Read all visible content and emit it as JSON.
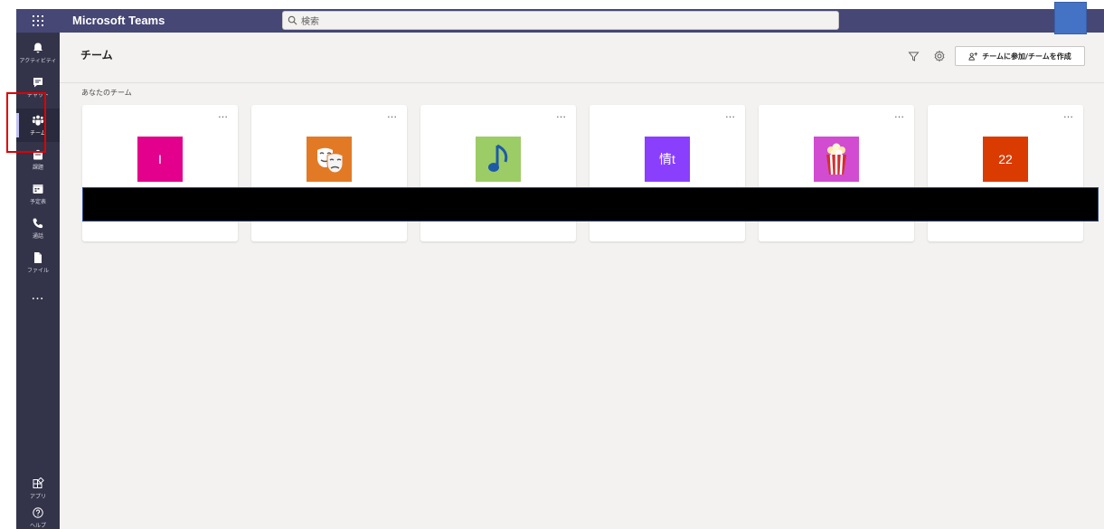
{
  "app": {
    "title": "Microsoft Teams"
  },
  "search": {
    "placeholder": "検索"
  },
  "rail": {
    "items": [
      {
        "label": "アクティビティ",
        "icon": "bell-icon"
      },
      {
        "label": "チャット",
        "icon": "chat-icon"
      },
      {
        "label": "チーム",
        "icon": "teams-icon",
        "active": true
      },
      {
        "label": "課題",
        "icon": "assignments-icon"
      },
      {
        "label": "予定表",
        "icon": "calendar-icon"
      },
      {
        "label": "通話",
        "icon": "phone-icon"
      },
      {
        "label": "ファイル",
        "icon": "file-icon"
      }
    ],
    "more": "…",
    "bottom": [
      {
        "label": "アプリ",
        "icon": "apps-icon"
      },
      {
        "label": "ヘルプ",
        "icon": "help-icon"
      }
    ]
  },
  "header": {
    "title": "チーム",
    "join_button": "チームに参加/チームを作成",
    "filter_icon": "filter-icon",
    "settings_icon": "gear-icon"
  },
  "section": {
    "label": "あなたのチーム"
  },
  "cards": [
    {
      "tile_text": "I",
      "tile_color": "#e3008c",
      "more": "…"
    },
    {
      "tile_text": "",
      "tile_color": "#e27a25",
      "icon": "theater-masks-icon",
      "more": "…"
    },
    {
      "tile_text": "",
      "tile_color": "#9ccc65",
      "icon": "music-note-icon",
      "more": "…"
    },
    {
      "tile_text": "情t",
      "tile_color": "#8a3ffc",
      "more": "…"
    },
    {
      "tile_text": "",
      "tile_color": "#d14cd1",
      "icon": "popcorn-icon",
      "more": "…"
    },
    {
      "tile_text": "22",
      "tile_color": "#da3b01",
      "more": "…"
    }
  ],
  "colors": {
    "topbar": "#464775",
    "rail": "#33344a",
    "canvas": "#f3f2f1",
    "highlight": "#e00000",
    "avatar": "#4472c4"
  }
}
